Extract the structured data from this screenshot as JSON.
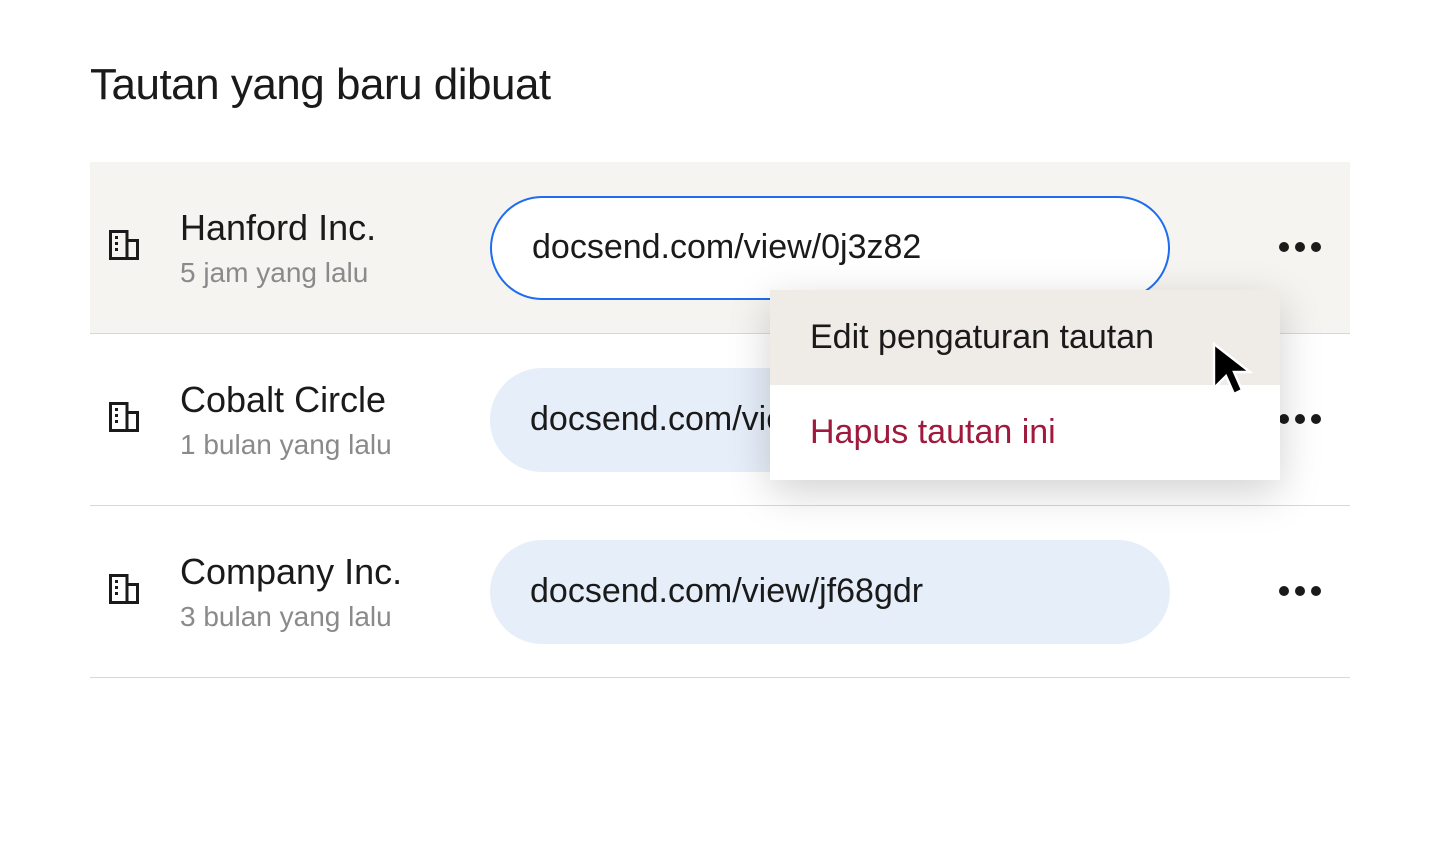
{
  "header": {
    "title": "Tautan yang baru dibuat"
  },
  "rows": [
    {
      "company": "Hanford Inc.",
      "timestamp": "5 jam yang lalu",
      "link": "docsend.com/view/0j3z82"
    },
    {
      "company": "Cobalt Circle",
      "timestamp": "1 bulan yang lalu",
      "link": "docsend.com/view/pr72fsm"
    },
    {
      "company": "Company Inc.",
      "timestamp": "3 bulan yang lalu",
      "link": "docsend.com/view/jf68gdr"
    }
  ],
  "dropdown": {
    "edit": "Edit pengaturan tautan",
    "delete": "Hapus tautan ini"
  }
}
